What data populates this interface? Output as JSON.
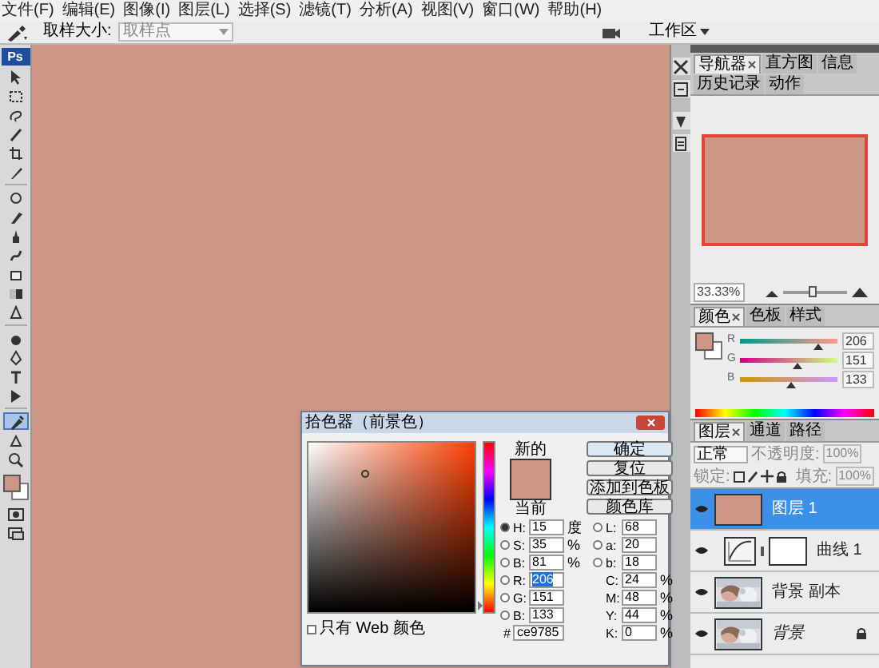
{
  "menu": [
    "文件(F)",
    "编辑(E)",
    "图像(I)",
    "图层(L)",
    "选择(S)",
    "滤镜(T)",
    "分析(A)",
    "视图(V)",
    "窗口(W)",
    "帮助(H)"
  ],
  "options_bar": {
    "sample_label": "取样大小:",
    "sample_value": "取样点",
    "workspace": "工作区"
  },
  "toolbox": {
    "logo": "Ps",
    "tools": [
      {
        "selected": false
      },
      {
        "selected": false
      },
      {
        "selected": false
      },
      {
        "selected": false
      },
      {
        "selected": false
      },
      {
        "selected": false
      },
      {
        "selected": false
      },
      {
        "selected": false
      },
      {
        "selected": false
      },
      {
        "selected": false
      },
      {
        "selected": false
      },
      {
        "selected": false
      },
      {
        "selected": false
      },
      {
        "selected": false
      },
      {
        "selected": false
      },
      {
        "selected": false
      },
      {
        "selected": false
      },
      {
        "selected": true
      },
      {
        "selected": false
      },
      {
        "selected": false
      }
    ]
  },
  "navigator": {
    "tabs": [
      {
        "label": "导航器",
        "selected": true
      },
      {
        "label": "直方图",
        "selected": false
      },
      {
        "label": "信息",
        "selected": false
      },
      {
        "label": "历史记录",
        "selected": false
      },
      {
        "label": "动作",
        "selected": false
      }
    ],
    "zoom": "33.33%",
    "zoom_slider": {
      "level": 0.45
    }
  },
  "color_panel": {
    "tabs": [
      {
        "label": "颜色",
        "selected": true
      },
      {
        "label": "色板",
        "selected": false
      },
      {
        "label": "样式",
        "selected": false
      }
    ],
    "sliders": [
      {
        "label": "R",
        "value": "206",
        "level": 0.81
      },
      {
        "label": "G",
        "value": "151",
        "level": 0.59
      },
      {
        "label": "B",
        "value": "133",
        "level": 0.52
      }
    ]
  },
  "layers_panel": {
    "tabs": [
      {
        "label": "图层",
        "selected": true
      },
      {
        "label": "通道",
        "selected": false
      },
      {
        "label": "路径",
        "selected": false
      }
    ],
    "blend_mode": "正常",
    "opacity_label": "不透明度:",
    "opacity": "100%",
    "lock_label": "锁定:",
    "fill_label": "填充:",
    "fill": "100%",
    "layers": [
      {
        "name": "图层 1",
        "kind": "fill",
        "selected": true,
        "visible": true,
        "locked": false
      },
      {
        "name": "曲线 1",
        "kind": "adjustment",
        "selected": false,
        "visible": true,
        "locked": false
      },
      {
        "name": "背景 副本",
        "selected": false,
        "visible": true,
        "locked": false
      },
      {
        "name": "背景",
        "selected": false,
        "visible": true,
        "locked": true
      }
    ]
  },
  "color_picker": {
    "title": "拾色器（前景色）",
    "new_label": "新的",
    "current_label": "当前",
    "buttons": [
      "确定",
      "复位",
      "添加到色板",
      "颜色库"
    ],
    "hsb_rgb": [
      {
        "label": "H:",
        "value": "15",
        "unit": "度",
        "selected": true,
        "focused": false
      },
      {
        "label": "S:",
        "value": "35",
        "unit": "%",
        "selected": false,
        "focused": false
      },
      {
        "label": "B:",
        "value": "81",
        "unit": "%",
        "selected": false,
        "focused": false
      },
      {
        "label": "R:",
        "value": "206",
        "selected": false,
        "focused": true
      },
      {
        "label": "G:",
        "value": "151",
        "selected": false,
        "focused": false
      },
      {
        "label": "B:",
        "value": "133",
        "selected": false,
        "focused": false
      }
    ],
    "lab_cmyk": [
      {
        "label": "L:",
        "value": "68",
        "selected": false
      },
      {
        "label": "a:",
        "value": "20",
        "selected": false
      },
      {
        "label": "b:",
        "value": "18",
        "selected": false
      },
      {
        "label": "C:",
        "value": "24",
        "unit": "%"
      },
      {
        "label": "M:",
        "value": "48",
        "unit": "%"
      },
      {
        "label": "Y:",
        "value": "44",
        "unit": "%"
      },
      {
        "label": "K:",
        "value": "0",
        "unit": "%"
      }
    ],
    "hue_slider": {
      "level": 0.04
    },
    "hex_label": "#",
    "hex": "ce9785",
    "web_only": {
      "label": "只有 Web 颜色",
      "checked": false
    }
  }
}
